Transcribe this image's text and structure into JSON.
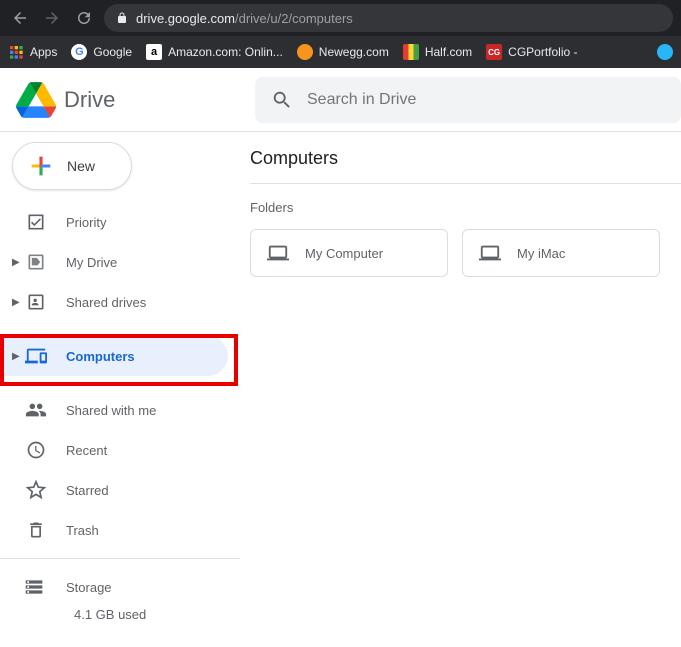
{
  "browser": {
    "url_plain": "drive.google.com/drive/u/2/computers",
    "bookmarks": [
      {
        "label": "Apps",
        "icon": "apps"
      },
      {
        "label": "Google",
        "icon": "google"
      },
      {
        "label": "Amazon.com: Onlin...",
        "icon": "amazon"
      },
      {
        "label": "Newegg.com",
        "icon": "newegg"
      },
      {
        "label": "Half.com",
        "icon": "half"
      },
      {
        "label": "CGPortfolio -",
        "icon": "cg"
      }
    ]
  },
  "header": {
    "app_name": "Drive",
    "search_placeholder": "Search in Drive"
  },
  "sidebar": {
    "new_label": "New",
    "items": [
      {
        "label": "Priority",
        "icon": "priority",
        "expandable": false,
        "active": false
      },
      {
        "label": "My Drive",
        "icon": "mydrive",
        "expandable": true,
        "active": false
      },
      {
        "label": "Shared drives",
        "icon": "shareddrives",
        "expandable": true,
        "active": false
      },
      {
        "label": "Computers",
        "icon": "computers",
        "expandable": true,
        "active": true
      },
      {
        "label": "Shared with me",
        "icon": "shared",
        "expandable": false,
        "active": false
      },
      {
        "label": "Recent",
        "icon": "recent",
        "expandable": false,
        "active": false
      },
      {
        "label": "Starred",
        "icon": "starred",
        "expandable": false,
        "active": false
      },
      {
        "label": "Trash",
        "icon": "trash",
        "expandable": false,
        "active": false
      }
    ],
    "storage_label": "Storage",
    "storage_used": "4.1 GB used"
  },
  "content": {
    "title": "Computers",
    "section_label": "Folders",
    "folders": [
      {
        "label": "My Computer"
      },
      {
        "label": "My iMac"
      }
    ]
  }
}
